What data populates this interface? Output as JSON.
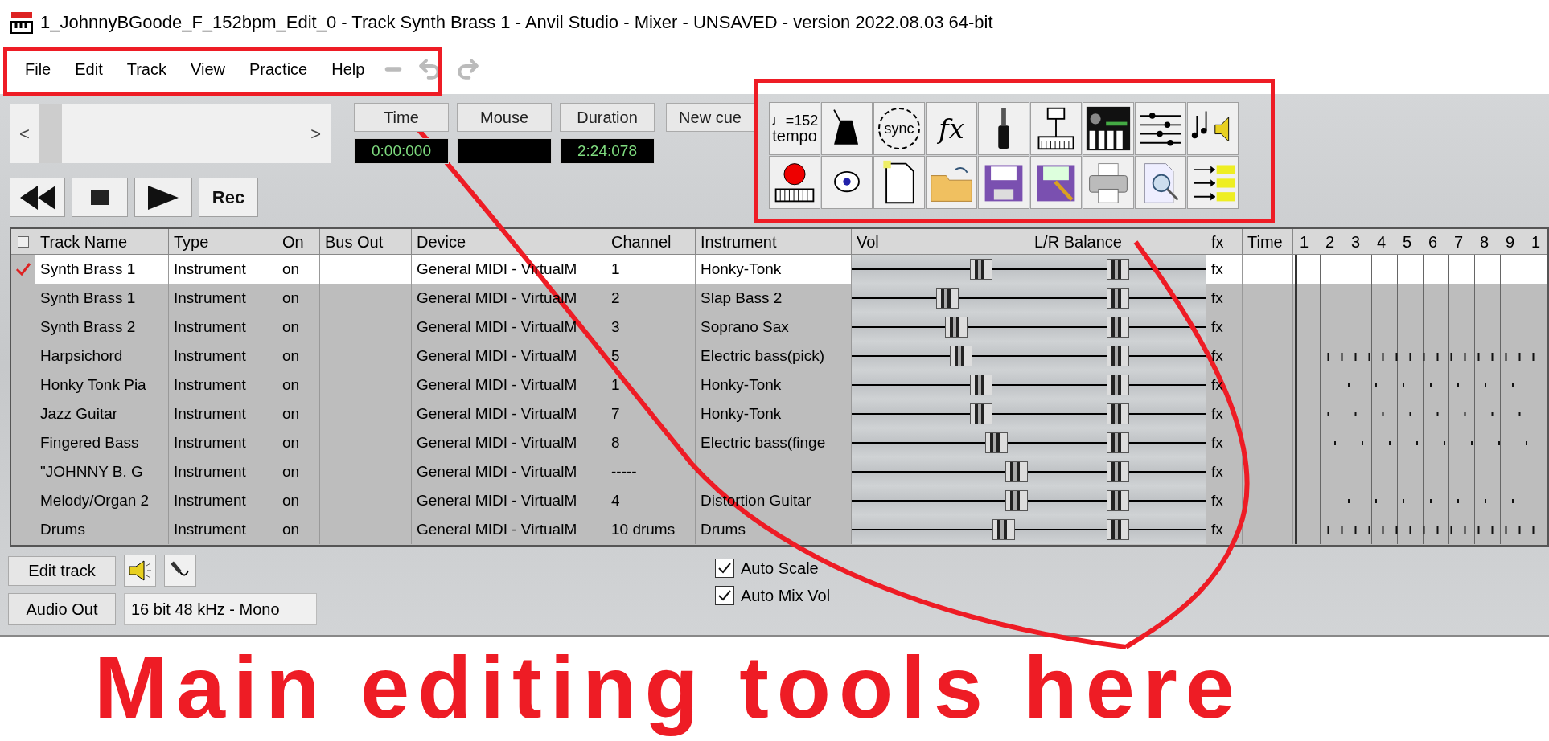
{
  "window": {
    "title": "1_JohnnyBGoode_F_152bpm_Edit_0 - Track Synth Brass 1 - Anvil Studio - Mixer - UNSAVED - version 2022.08.03 64-bit"
  },
  "menu": [
    "File",
    "Edit",
    "Track",
    "View",
    "Practice",
    "Help"
  ],
  "scroll": {
    "left": "<",
    "right": ">"
  },
  "readouts": [
    {
      "label": "Time",
      "value": "0:00:000"
    },
    {
      "label": "Mouse"
    },
    {
      "label": "Duration",
      "value": "2:24:078"
    }
  ],
  "cue_button": "New cue",
  "transport": [
    {
      "kind": "rewind"
    },
    {
      "kind": "stop"
    },
    {
      "kind": "play"
    },
    {
      "kind": "record",
      "label": "Rec"
    }
  ],
  "toolbar": [
    {
      "kind": "tempo",
      "label": "♩=152",
      "caption": "tempo"
    },
    {
      "kind": "metronome"
    },
    {
      "kind": "sync",
      "label": "sync"
    },
    {
      "kind": "fx",
      "label": "fx"
    },
    {
      "kind": "jack"
    },
    {
      "kind": "midi-setup"
    },
    {
      "kind": "synth"
    },
    {
      "kind": "mixer"
    },
    {
      "kind": "notes-speaker"
    },
    {
      "kind": "record-keyboard"
    },
    {
      "kind": "help"
    },
    {
      "kind": "new"
    },
    {
      "kind": "open"
    },
    {
      "kind": "save"
    },
    {
      "kind": "save-as"
    },
    {
      "kind": "print"
    },
    {
      "kind": "preview"
    },
    {
      "kind": "tracks"
    }
  ],
  "table": {
    "columns": [
      "Track Name",
      "Type",
      "On",
      "Bus Out",
      "Device",
      "Channel",
      "Instrument",
      "Vol",
      "L/R Balance",
      "fx",
      "Time"
    ],
    "select_all": {
      "checked": false
    },
    "bars": [
      "1",
      "2",
      "3",
      "4",
      "5",
      "6",
      "7",
      "8",
      "9",
      "1"
    ],
    "rows": [
      {
        "name": "Synth Brass 1",
        "type": "Instrument",
        "on": "on",
        "device": "General MIDI - VirtualM",
        "channel": "1",
        "instrument": "Honky-Tonk",
        "vol": {
          "level": 0.73
        },
        "balance": {
          "level": 0.5
        },
        "fx": "fx",
        "selected": true,
        "checked": true
      },
      {
        "name": "Synth Brass 1",
        "type": "Instrument",
        "on": "on",
        "device": "General MIDI - VirtualM",
        "channel": "2",
        "instrument": "Slap Bass 2",
        "vol": {
          "level": 0.54
        },
        "balance": {
          "level": 0.5
        },
        "fx": "fx",
        "selected": false,
        "checked": false
      },
      {
        "name": "Synth Brass 2",
        "type": "Instrument",
        "on": "on",
        "device": "General MIDI - VirtualM",
        "channel": "3",
        "instrument": "Soprano Sax",
        "vol": {
          "level": 0.59
        },
        "balance": {
          "level": 0.5
        },
        "fx": "fx",
        "selected": false,
        "checked": false
      },
      {
        "name": "Harpsichord",
        "type": "Instrument",
        "on": "on",
        "device": "General MIDI - VirtualM",
        "channel": "5",
        "instrument": "Electric bass(pick)",
        "vol": {
          "level": 0.62
        },
        "balance": {
          "level": 0.5
        },
        "fx": "fx",
        "selected": false,
        "checked": false
      },
      {
        "name": "Honky Tonk Pia",
        "type": "Instrument",
        "on": "on",
        "device": "General MIDI - VirtualM",
        "channel": "1",
        "instrument": "Honky-Tonk",
        "vol": {
          "level": 0.73
        },
        "balance": {
          "level": 0.5
        },
        "fx": "fx",
        "selected": false,
        "checked": false
      },
      {
        "name": "Jazz Guitar",
        "type": "Instrument",
        "on": "on",
        "device": "General MIDI - VirtualM",
        "channel": "7",
        "instrument": "Honky-Tonk",
        "vol": {
          "level": 0.73
        },
        "balance": {
          "level": 0.5
        },
        "fx": "fx",
        "selected": false,
        "checked": false
      },
      {
        "name": "Fingered Bass",
        "type": "Instrument",
        "on": "on",
        "device": "General MIDI - VirtualM",
        "channel": "8",
        "instrument": "Electric bass(finge",
        "vol": {
          "level": 0.82
        },
        "balance": {
          "level": 0.5
        },
        "fx": "fx",
        "selected": false,
        "checked": false
      },
      {
        "name": "\"JOHNNY B. G",
        "type": "Instrument",
        "on": "on",
        "device": "General MIDI - VirtualM",
        "channel": "-----",
        "vol": {
          "level": 0.93
        },
        "balance": {
          "level": 0.5
        },
        "fx": "fx",
        "selected": false,
        "checked": false
      },
      {
        "name": "Melody/Organ 2",
        "type": "Instrument",
        "on": "on",
        "device": "General MIDI - VirtualM",
        "channel": "4",
        "instrument": "Distortion Guitar",
        "vol": {
          "level": 0.93
        },
        "balance": {
          "level": 0.5
        },
        "fx": "fx",
        "selected": false,
        "checked": false
      },
      {
        "name": "Drums",
        "type": "Instrument",
        "on": "on",
        "device": "General MIDI - VirtualM",
        "channel": "10 drums",
        "instrument": "Drums",
        "vol": {
          "level": 0.86
        },
        "balance": {
          "level": 0.5
        },
        "fx": "fx",
        "selected": false,
        "checked": false
      }
    ]
  },
  "bottom": {
    "edit_button": "Edit track",
    "audio_button": "Audio Out",
    "audio_format": "16 bit 48 kHz - Mono",
    "options": [
      {
        "label": "Auto Scale",
        "checked": true
      },
      {
        "label": "Auto Mix Vol",
        "checked": true
      }
    ]
  },
  "annotation": {
    "caption": "Main editing tools here"
  }
}
